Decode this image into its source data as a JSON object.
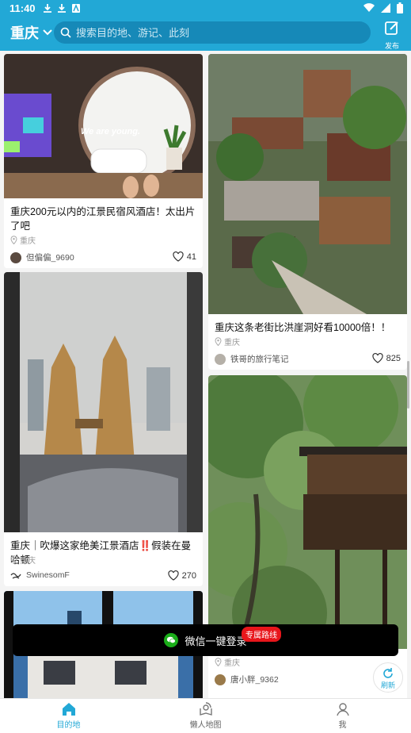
{
  "status": {
    "time": "11:40"
  },
  "header": {
    "city": "重庆",
    "search_placeholder": "搜索目的地、游记、此刻",
    "publish_label": "发布"
  },
  "cards": [
    {
      "title": "重庆200元以内的江景民宿风酒店！太出片了吧",
      "location": "重庆",
      "author": "但偏偏_9690",
      "likes": "41"
    },
    {
      "title": "重庆这条老街比洪崖洞好看10000倍！！",
      "location": "重庆",
      "author": "铁哥的旅行笔记",
      "likes": "825"
    },
    {
      "title": "重庆｜吹爆这家绝美江景酒店‼️假装在曼哈顿",
      "location": "重庆",
      "author": "SwinesomF",
      "likes": "270"
    },
    {
      "title": "",
      "location": "重庆",
      "author": "唐小胖_9362",
      "likes": ""
    }
  ],
  "image_text": {
    "mirror_text": "We are young."
  },
  "login": {
    "label": "微信一键登录",
    "badge": "专属路线"
  },
  "refresh_label": "刷新",
  "nav": [
    {
      "label": "目的地"
    },
    {
      "label": "懒人地图"
    },
    {
      "label": "我"
    }
  ],
  "colors": {
    "primary": "#22a8d6",
    "badge": "#e8161b",
    "wechat": "#1aad19"
  }
}
